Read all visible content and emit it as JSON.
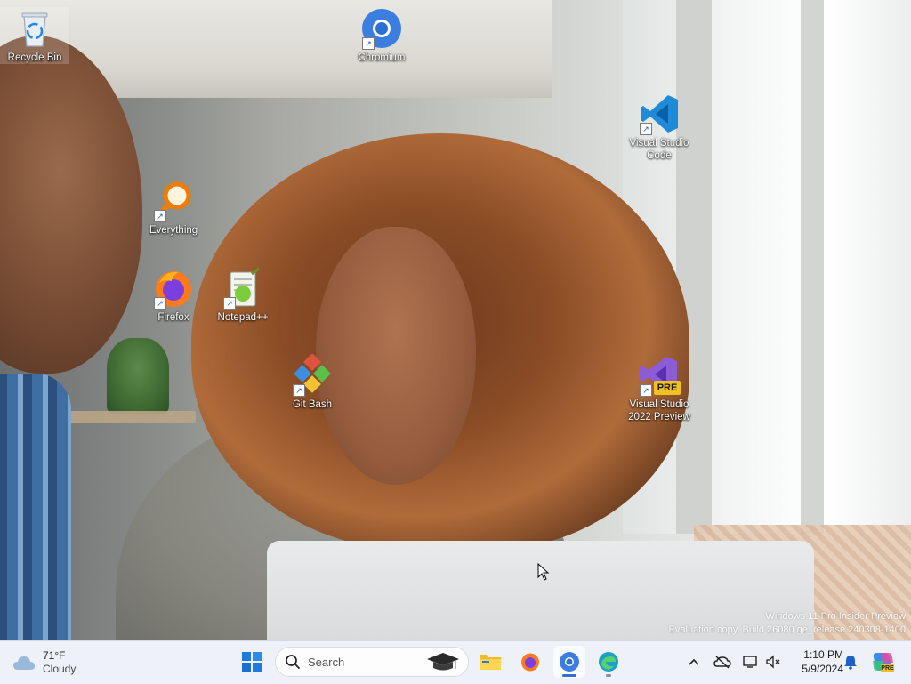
{
  "desktop": {
    "icons": [
      {
        "id": "recycle-bin",
        "label": "Recycle Bin"
      },
      {
        "id": "chromium",
        "label": "Chromium"
      },
      {
        "id": "vscode",
        "label_line1": "Visual Studio",
        "label_line2": "Code"
      },
      {
        "id": "everything",
        "label": "Everything"
      },
      {
        "id": "firefox",
        "label": "Firefox"
      },
      {
        "id": "notepadpp",
        "label": "Notepad++"
      },
      {
        "id": "git-bash",
        "label": "Git Bash"
      },
      {
        "id": "vs2022",
        "label_line1": "Visual Studio",
        "label_line2": "2022 Preview",
        "badge": "PRE"
      }
    ],
    "watermark": {
      "line1": "Windows 11 Pro Insider Preview",
      "line2": "Evaluation copy. Build 26080.ge_release.240308-1400"
    }
  },
  "taskbar": {
    "weather": {
      "temp": "71°F",
      "condition": "Cloudy"
    },
    "search": {
      "placeholder": "Search"
    },
    "pinned": [
      "start",
      "file-explorer",
      "firefox",
      "chromium",
      "edge"
    ],
    "active_app": "chromium",
    "clock": {
      "time": "1:10 PM",
      "date": "5/9/2024"
    }
  },
  "colors": {
    "accent": "#2f6fd6",
    "taskbar_bg": "#eef1f7"
  }
}
